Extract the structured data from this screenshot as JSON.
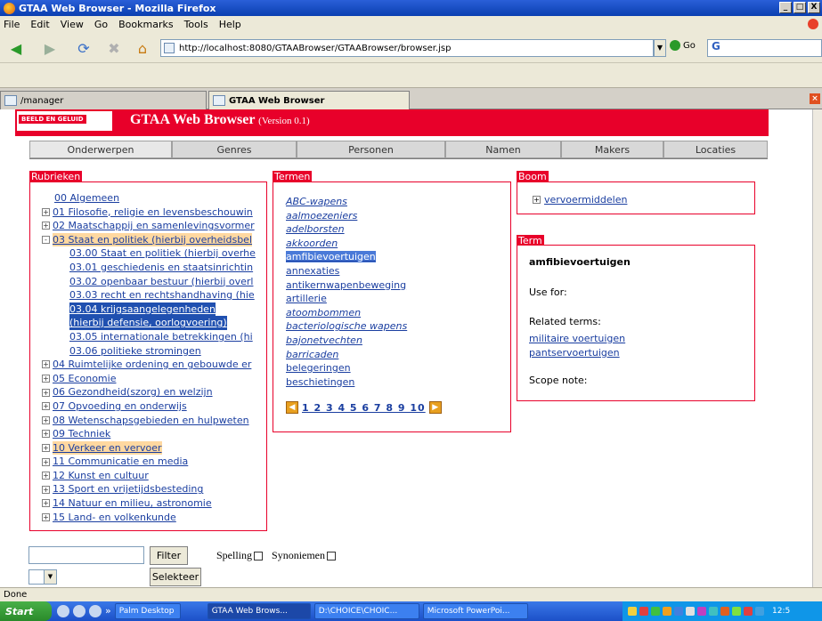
{
  "window": {
    "title": "GTAA Web Browser - Mozilla Firefox",
    "buttons": {
      "minimize": "_",
      "maximize": "□",
      "close": "X"
    }
  },
  "menu": [
    "File",
    "Edit",
    "View",
    "Go",
    "Bookmarks",
    "Tools",
    "Help"
  ],
  "address": {
    "url": "http://localhost:8080/GTAABrowser/GTAABrowser/browser.jsp",
    "go_label": "Go",
    "search_text": "G"
  },
  "browser_tabs": [
    {
      "label": "/manager"
    },
    {
      "label": "GTAA Web Browser"
    }
  ],
  "header": {
    "logo": "BEELD EN GELUID",
    "title": "GTAA Web Browser",
    "version": "(Version 0.1)"
  },
  "nav_tabs": [
    "Onderwerpen",
    "Genres",
    "Personen",
    "Namen",
    "Makers",
    "Locaties"
  ],
  "panels": {
    "rubrieken": "Rubrieken",
    "termen": "Termen",
    "boom": "Boom",
    "term": "Term"
  },
  "rubrieken": [
    {
      "label": "00 Algemeen",
      "expander": "",
      "level": 0,
      "state": ""
    },
    {
      "label": "01 Filosofie, religie en levensbeschouwin",
      "expander": "+",
      "level": 0,
      "state": ""
    },
    {
      "label": "02 Maatschappij en samenlevingsvormer",
      "expander": "+",
      "level": 0,
      "state": ""
    },
    {
      "label": "03 Staat en politiek (hierbij overheidsbel",
      "expander": "-",
      "level": 0,
      "state": "orange"
    },
    {
      "label": "03.00 Staat en politiek (hierbij overhe",
      "expander": "",
      "level": 1,
      "state": ""
    },
    {
      "label": "03.01 geschiedenis en staatsinrichtin",
      "expander": "",
      "level": 1,
      "state": ""
    },
    {
      "label": "03.02 openbaar bestuur (hierbij overl",
      "expander": "",
      "level": 1,
      "state": ""
    },
    {
      "label": "03.03 recht en rechtshandhaving (hie",
      "expander": "",
      "level": 1,
      "state": ""
    },
    {
      "label": "03.04 krijgsaangelegenheden",
      "expander": "",
      "level": 1,
      "state": "selected"
    },
    {
      "label": "(hierbij defensie, oorlogvoering)",
      "expander": "",
      "level": 1,
      "state": "selected"
    },
    {
      "label": "03.05 internationale betrekkingen (hi",
      "expander": "",
      "level": 1,
      "state": ""
    },
    {
      "label": "03.06 politieke stromingen",
      "expander": "",
      "level": 1,
      "state": ""
    },
    {
      "label": "04 Ruimtelijke ordening en gebouwde er",
      "expander": "+",
      "level": 0,
      "state": ""
    },
    {
      "label": "05 Economie",
      "expander": "+",
      "level": 0,
      "state": ""
    },
    {
      "label": "06 Gezondheid(szorg) en welzijn",
      "expander": "+",
      "level": 0,
      "state": ""
    },
    {
      "label": "07 Opvoeding en onderwijs",
      "expander": "+",
      "level": 0,
      "state": ""
    },
    {
      "label": "08 Wetenschapsgebieden en hulpweten",
      "expander": "+",
      "level": 0,
      "state": ""
    },
    {
      "label": "09 Techniek",
      "expander": "+",
      "level": 0,
      "state": ""
    },
    {
      "label": "10 Verkeer en vervoer",
      "expander": "+",
      "level": 0,
      "state": "orange"
    },
    {
      "label": "11 Communicatie en media",
      "expander": "+",
      "level": 0,
      "state": ""
    },
    {
      "label": "12 Kunst en cultuur",
      "expander": "+",
      "level": 0,
      "state": ""
    },
    {
      "label": "13 Sport en vrijetijdsbesteding",
      "expander": "+",
      "level": 0,
      "state": ""
    },
    {
      "label": "14 Natuur en milieu, astronomie",
      "expander": "+",
      "level": 0,
      "state": ""
    },
    {
      "label": "15 Land- en volkenkunde",
      "expander": "+",
      "level": 0,
      "state": ""
    }
  ],
  "termen": [
    {
      "label": "ABC-wapens",
      "italic": true,
      "selected": false
    },
    {
      "label": "aalmoezeniers",
      "italic": true,
      "selected": false
    },
    {
      "label": "adelborsten",
      "italic": true,
      "selected": false
    },
    {
      "label": "akkoorden",
      "italic": true,
      "selected": false
    },
    {
      "label": "amfibievoertuigen",
      "italic": false,
      "selected": true
    },
    {
      "label": "annexaties",
      "italic": false,
      "selected": false
    },
    {
      "label": "antikernwapenbeweging",
      "italic": false,
      "selected": false
    },
    {
      "label": "artillerie",
      "italic": false,
      "selected": false
    },
    {
      "label": "atoombommen",
      "italic": true,
      "selected": false
    },
    {
      "label": "bacteriologische  wapens",
      "italic": true,
      "selected": false
    },
    {
      "label": "bajonetvechten",
      "italic": true,
      "selected": false
    },
    {
      "label": "barricaden",
      "italic": true,
      "selected": false
    },
    {
      "label": "belegeringen",
      "italic": false,
      "selected": false
    },
    {
      "label": "beschietingen",
      "italic": false,
      "selected": false
    }
  ],
  "pager": {
    "pages": "1 2 3 4 5 6 7 8 9 10",
    "prev": "◀",
    "next": "▶"
  },
  "boom": {
    "node": "vervoermiddelen",
    "expander": "+"
  },
  "term_detail": {
    "name": "amfibievoertuigen",
    "use_for": "Use for:",
    "related_label": "Related terms:",
    "related": [
      "militaire  voertuigen",
      "pantservoertuigen"
    ],
    "scope_note": "Scope note:"
  },
  "controls": {
    "filter_label": "Filter",
    "spelling_label": "Spelling",
    "synoniemen_label": "Synoniemen",
    "select_label": "Selekteer"
  },
  "status": "Done",
  "taskbar": {
    "start": "Start",
    "more": "»",
    "items": [
      "Palm Desktop",
      "GTAA Web Brows...",
      "D:\\CHOICE\\CHOIC...",
      "Microsoft PowerPoi..."
    ],
    "clock": "12:5"
  }
}
